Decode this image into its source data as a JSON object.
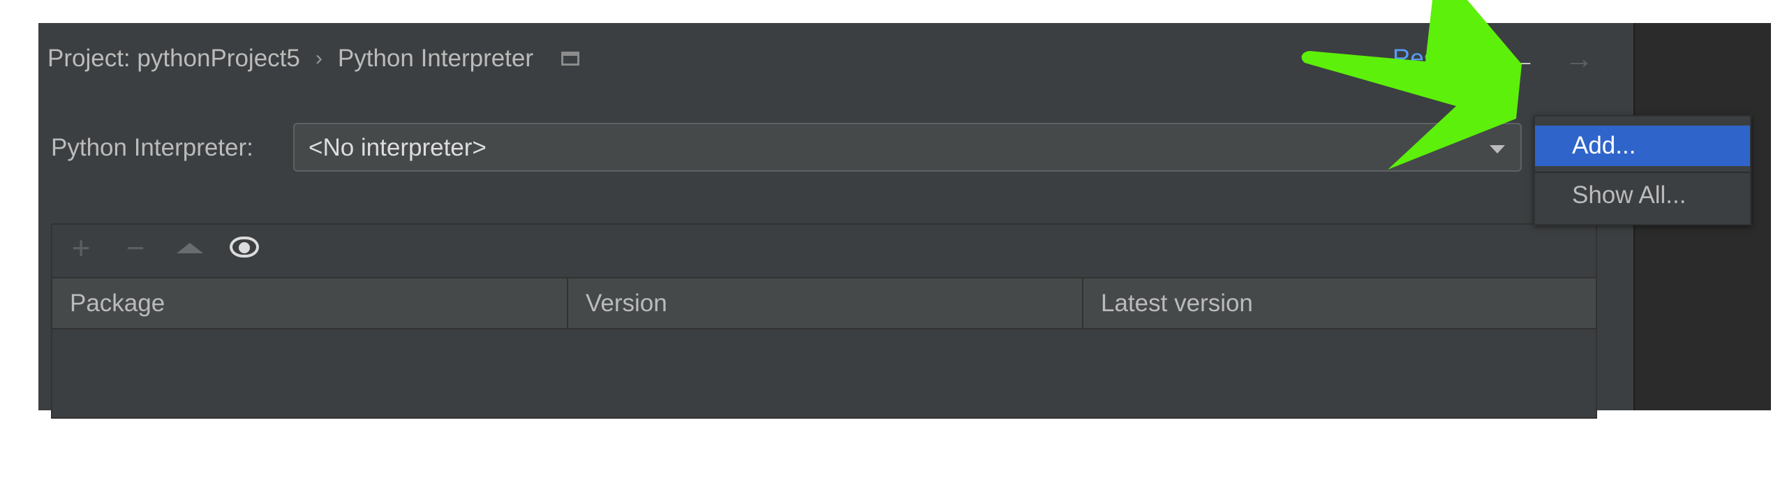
{
  "breadcrumb": {
    "project": "Project: pythonProject5",
    "separator": "›",
    "page": "Python Interpreter"
  },
  "header": {
    "reset_link": "Reset",
    "back_icon": "arrow-left-icon",
    "forward_icon": "arrow-right-icon"
  },
  "interpreter": {
    "label": "Python Interpreter:",
    "value": "<No interpreter>"
  },
  "toolbar": {
    "add_icon": "+",
    "remove_icon": "−"
  },
  "table": {
    "columns": [
      "Package",
      "Version",
      "Latest version"
    ],
    "rows": []
  },
  "dropdown": {
    "items": [
      "Add...",
      "Show All..."
    ],
    "selected": "Add..."
  },
  "colors": {
    "panel_bg": "#3c3f41",
    "selection_blue": "#2f65ca",
    "link_blue": "#589df6",
    "annotation_green": "#5cf00a"
  }
}
